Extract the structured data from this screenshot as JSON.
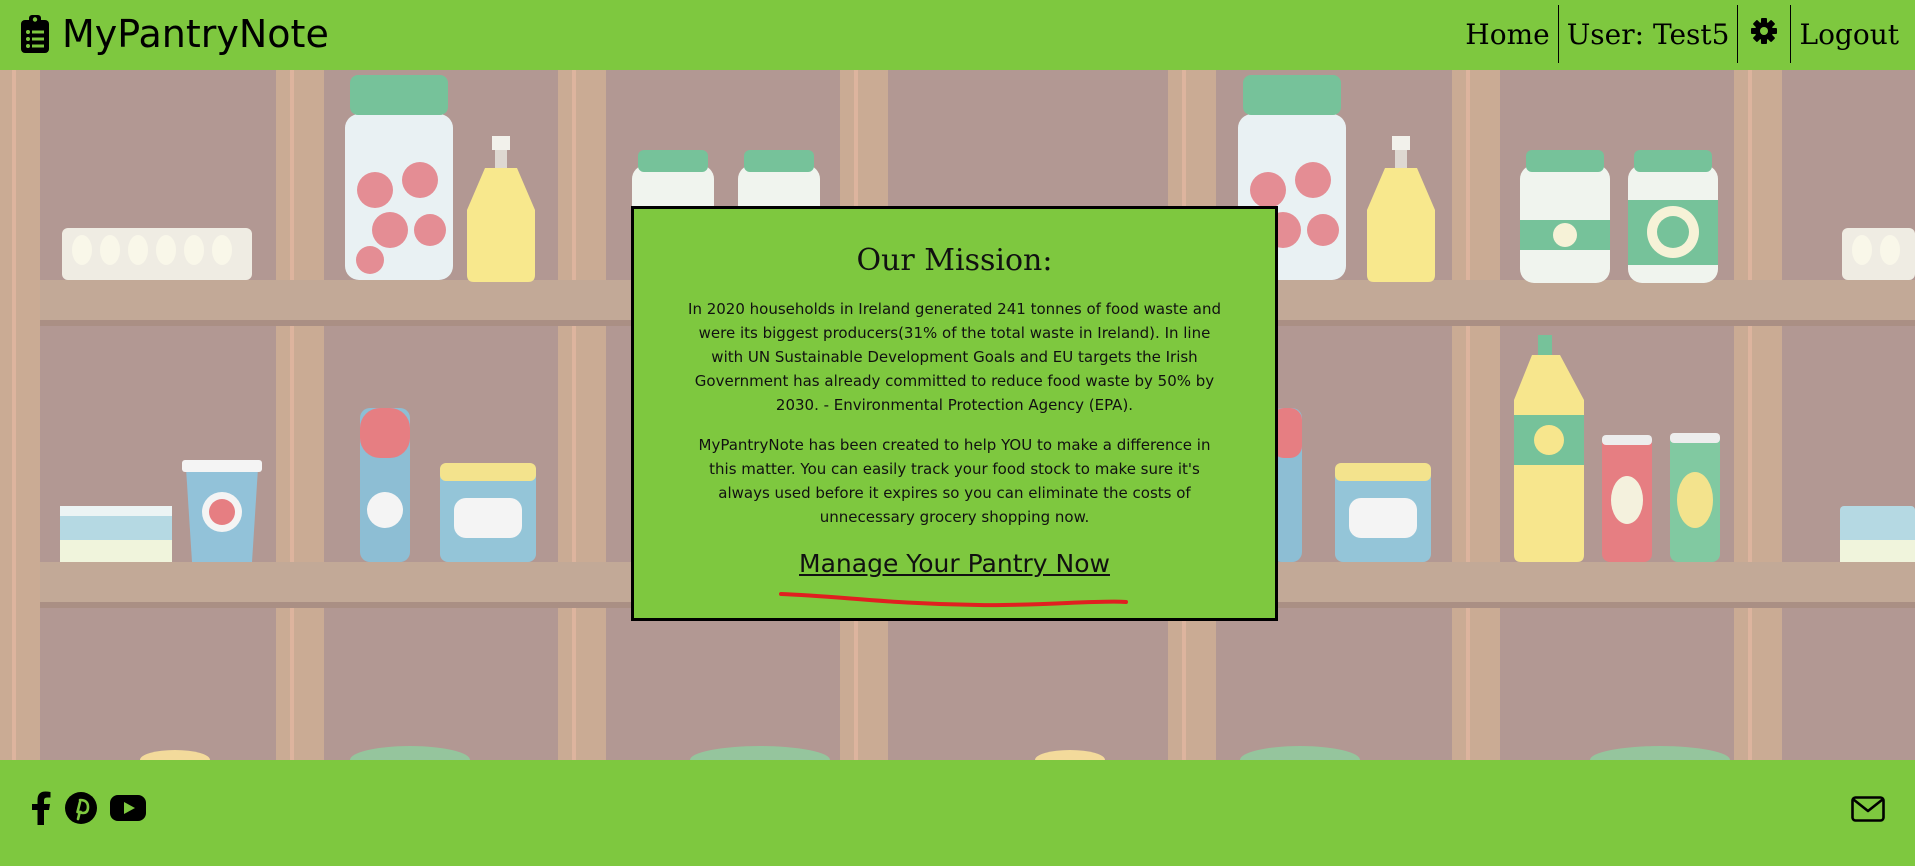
{
  "header": {
    "brand": "MyPantryNote",
    "brand_icon": "clipboard-list-icon",
    "nav": {
      "home": "Home",
      "user": "User: Test5",
      "settings_icon": "gear-icon",
      "logout": "Logout"
    }
  },
  "mission": {
    "title": "Our Mission:",
    "paragraph1": "In 2020 households in Ireland generated 241 tonnes of food waste and were its biggest producers(31% of the total waste in Ireland). In line with UN Sustainable Development Goals and EU targets the Irish Government has already committed to reduce food waste by 50% by 2030. - Environmental Protection Agency (EPA).",
    "paragraph2": "MyPantryNote has been created to help YOU to make a difference in this matter. You can easily track your food stock to make sure it's always used before it expires so you can eliminate the costs of unnecessary grocery shopping now.",
    "cta": "Manage Your Pantry Now"
  },
  "footer": {
    "social_icons": [
      "facebook-icon",
      "pinterest-icon",
      "youtube-icon"
    ],
    "contact_icon": "envelope-icon"
  },
  "colors": {
    "accent_green": "#7ec83f",
    "shelf_background": "#a58780",
    "annotation_red": "#e02020"
  }
}
